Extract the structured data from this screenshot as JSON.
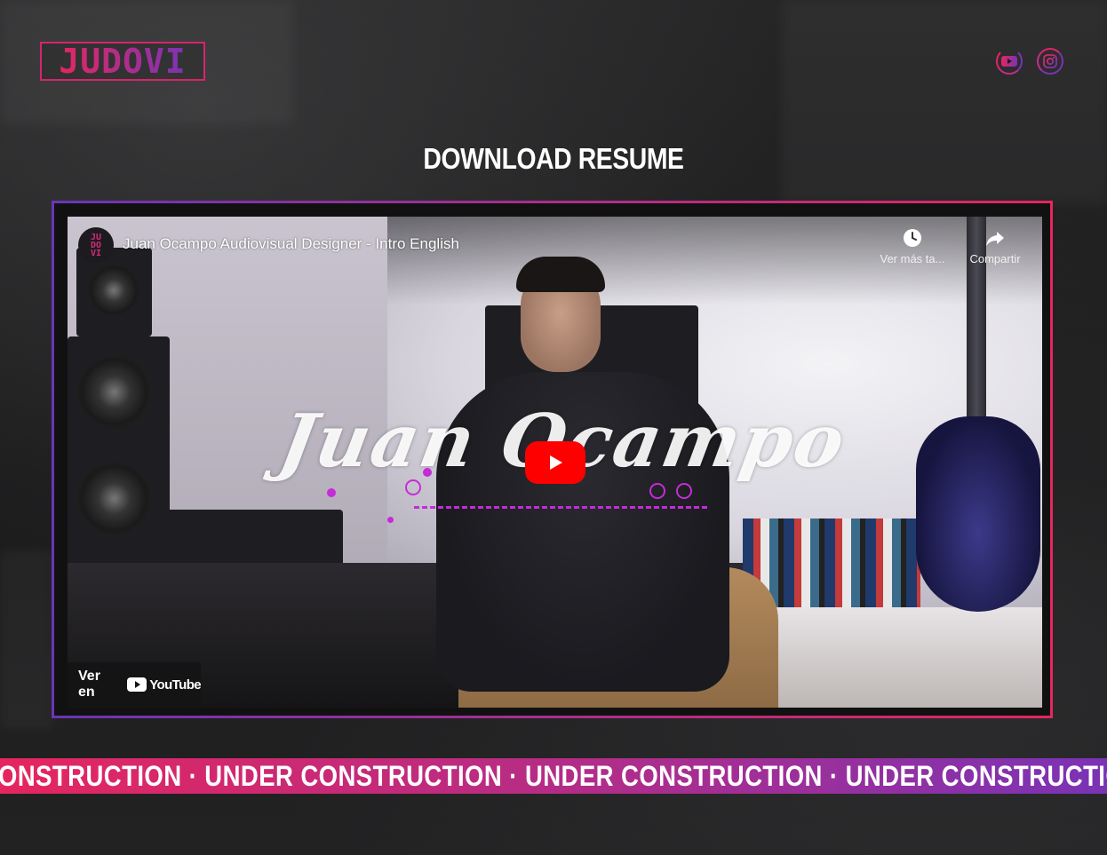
{
  "header": {
    "logo_text": "JUDOVI",
    "social": [
      {
        "name": "youtube",
        "icon": "youtube-icon"
      },
      {
        "name": "instagram",
        "icon": "instagram-icon"
      }
    ]
  },
  "main": {
    "title": "DOWNLOAD RESUME"
  },
  "video": {
    "title": "Juan Ocampo Audiovisual Designer - Intro English",
    "overlay_script": "Juan Ocampo",
    "watch_later_label": "Ver más ta...",
    "share_label": "Compartir",
    "watch_on_label": "Ver en",
    "watch_on_brand": "YouTube",
    "channel_avatar_text": "JUDOVI"
  },
  "marquee": {
    "text": "ONSTRUCTION · UNDER CONSTRUCTION · UNDER CONSTRUCTION · UNDER CONSTRUCTION · UNDER"
  },
  "colors": {
    "accent_pink": "#e5265f",
    "accent_magenta": "#b02d8a",
    "accent_purple": "#7a33b5",
    "youtube_red": "#ff0000"
  }
}
